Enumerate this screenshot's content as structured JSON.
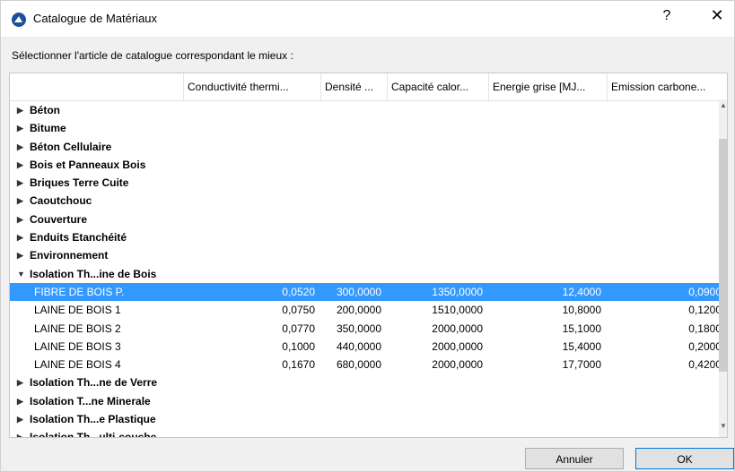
{
  "window": {
    "title": "Catalogue de Matériaux",
    "help_label": "?",
    "close_label": "✕"
  },
  "prompt": "Sélectionner l'article de catalogue correspondant le mieux :",
  "columns": [
    "Conductivité thermi...",
    "Densité ...",
    "Capacité calor...",
    "Energie grise [MJ...",
    "Emission carbone..."
  ],
  "groups_before": [
    "Béton",
    "Bitume",
    "Béton Cellulaire",
    "Bois et Panneaux Bois",
    "Briques Terre Cuite",
    "Caoutchouc",
    "Couverture",
    "Enduits Etanchéité",
    "Environnement"
  ],
  "expanded_group": "Isolation Th...ine de Bois",
  "items": [
    {
      "name": "FIBRE DE BOIS P.",
      "conductivite": "0,0520",
      "densite": "300,0000",
      "capacite": "1350,0000",
      "energie": "12,4000",
      "emission": "0,0900",
      "selected": true
    },
    {
      "name": "LAINE DE BOIS 1",
      "conductivite": "0,0750",
      "densite": "200,0000",
      "capacite": "1510,0000",
      "energie": "10,8000",
      "emission": "0,1200",
      "selected": false
    },
    {
      "name": "LAINE DE BOIS 2",
      "conductivite": "0,0770",
      "densite": "350,0000",
      "capacite": "2000,0000",
      "energie": "15,1000",
      "emission": "0,1800",
      "selected": false
    },
    {
      "name": "LAINE DE BOIS 3",
      "conductivite": "0,1000",
      "densite": "440,0000",
      "capacite": "2000,0000",
      "energie": "15,4000",
      "emission": "0,2000",
      "selected": false
    },
    {
      "name": "LAINE DE BOIS 4",
      "conductivite": "0,1670",
      "densite": "680,0000",
      "capacite": "2000,0000",
      "energie": "17,7000",
      "emission": "0,4200",
      "selected": false
    }
  ],
  "groups_after": [
    "Isolation Th...ne de Verre",
    "Isolation T...ne Minerale",
    "Isolation Th...e Plastique",
    "Isolation Th...ulti-couche"
  ],
  "buttons": {
    "cancel": "Annuler",
    "ok": "OK"
  },
  "colors": {
    "selection": "#3399ff",
    "ok_border": "#0078d7"
  }
}
